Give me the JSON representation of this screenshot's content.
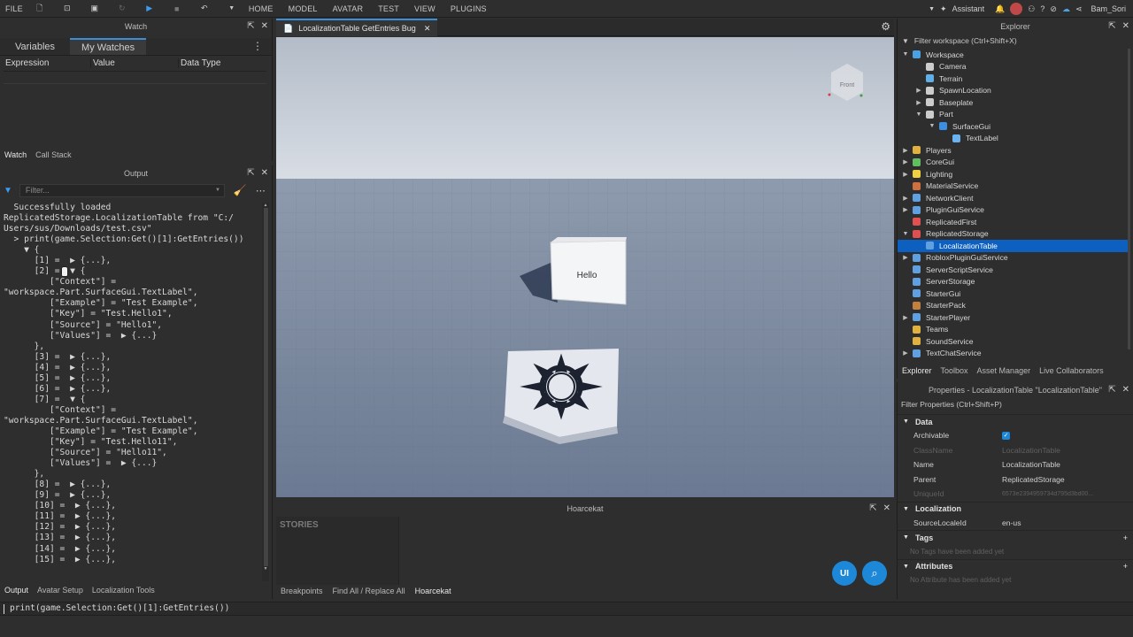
{
  "menu": {
    "file": "FILE",
    "items": [
      "HOME",
      "MODEL",
      "AVATAR",
      "TEST",
      "VIEW",
      "PLUGINS"
    ]
  },
  "topright": {
    "assistant": "Assistant",
    "user": "Bam_Sori"
  },
  "watch": {
    "title": "Watch",
    "tabs": [
      "Variables",
      "My Watches"
    ],
    "columns": [
      "Expression",
      "Value",
      "Data Type"
    ],
    "bottom_tabs": [
      "Watch",
      "Call Stack"
    ]
  },
  "output": {
    "title": "Output",
    "filter_placeholder": "Filter...",
    "lines": [
      "  Successfully loaded",
      "ReplicatedStorage.LocalizationTable from \"C:/",
      "Users/sus/Downloads/test.csv\"",
      "  > print(game.Selection:Get()[1]:GetEntries())",
      "    ▼ {",
      "      [1] =  ▶ {...},",
      "      [2] =  ▼ {",
      "         [\"Context\"] =",
      "\"workspace.Part.SurfaceGui.TextLabel\",",
      "         [\"Example\"] = \"Test Example\",",
      "         [\"Key\"] = \"Test.Hello1\",",
      "         [\"Source\"] = \"Hello1\",",
      "         [\"Values\"] =  ▶ {...}",
      "      },",
      "      [3] =  ▶ {...},",
      "      [4] =  ▶ {...},",
      "      [5] =  ▶ {...},",
      "      [6] =  ▶ {...},",
      "      [7] =  ▼ {",
      "         [\"Context\"] =",
      "\"workspace.Part.SurfaceGui.TextLabel\",",
      "         [\"Example\"] = \"Test Example\",",
      "         [\"Key\"] = \"Test.Hello11\",",
      "         [\"Source\"] = \"Hello11\",",
      "         [\"Values\"] =  ▶ {...}",
      "      },",
      "      [8] =  ▶ {...},",
      "      [9] =  ▶ {...},",
      "      [10] =  ▶ {...},",
      "      [11] =  ▶ {...},",
      "      [12] =  ▶ {...},",
      "      [13] =  ▶ {...},",
      "      [14] =  ▶ {...},",
      "      [15] =  ▶ {...},"
    ],
    "bottom_tabs": [
      "Output",
      "Avatar Setup",
      "Localization Tools"
    ]
  },
  "viewport": {
    "tab": "LocalizationTable GetEntries Bug",
    "part_text": "Hello",
    "cube_label": "Front"
  },
  "hoarcekat": {
    "title": "Hoarcekat",
    "stories": "STORIES",
    "bottom_tabs": [
      "Breakpoints",
      "Find All / Replace All",
      "Hoarcekat"
    ]
  },
  "explorer": {
    "title": "Explorer",
    "filter": "Filter workspace (Ctrl+Shift+X)",
    "items": [
      {
        "label": "Workspace",
        "depth": 0,
        "arrow": "▼",
        "color": "#4aa0e0"
      },
      {
        "label": "Camera",
        "depth": 1,
        "arrow": "",
        "color": "#cccccc"
      },
      {
        "label": "Terrain",
        "depth": 1,
        "arrow": "",
        "color": "#5fb0e8"
      },
      {
        "label": "SpawnLocation",
        "depth": 1,
        "arrow": "▶",
        "color": "#cccccc"
      },
      {
        "label": "Baseplate",
        "depth": 1,
        "arrow": "▶",
        "color": "#cccccc"
      },
      {
        "label": "Part",
        "depth": 1,
        "arrow": "▼",
        "color": "#cccccc"
      },
      {
        "label": "SurfaceGui",
        "depth": 2,
        "arrow": "▼",
        "color": "#3c8ee0"
      },
      {
        "label": "TextLabel",
        "depth": 3,
        "arrow": "",
        "color": "#6bb3f0"
      },
      {
        "label": "Players",
        "depth": 0,
        "arrow": "▶",
        "color": "#e0b040"
      },
      {
        "label": "CoreGui",
        "depth": 0,
        "arrow": "▶",
        "color": "#60c060"
      },
      {
        "label": "Lighting",
        "depth": 0,
        "arrow": "▶",
        "color": "#f0d040"
      },
      {
        "label": "MaterialService",
        "depth": 0,
        "arrow": "",
        "color": "#d07040"
      },
      {
        "label": "NetworkClient",
        "depth": 0,
        "arrow": "▶",
        "color": "#60a0e0"
      },
      {
        "label": "PluginGuiService",
        "depth": 0,
        "arrow": "▶",
        "color": "#60a0e0"
      },
      {
        "label": "ReplicatedFirst",
        "depth": 0,
        "arrow": "",
        "color": "#e05050"
      },
      {
        "label": "ReplicatedStorage",
        "depth": 0,
        "arrow": "▼",
        "color": "#e05050"
      },
      {
        "label": "LocalizationTable",
        "depth": 1,
        "arrow": "",
        "color": "#60a0e0",
        "selected": true
      },
      {
        "label": "RobloxPluginGuiService",
        "depth": 0,
        "arrow": "▶",
        "color": "#60a0e0"
      },
      {
        "label": "ServerScriptService",
        "depth": 0,
        "arrow": "",
        "color": "#60a0e0"
      },
      {
        "label": "ServerStorage",
        "depth": 0,
        "arrow": "",
        "color": "#60a0e0"
      },
      {
        "label": "StarterGui",
        "depth": 0,
        "arrow": "",
        "color": "#60a0e0"
      },
      {
        "label": "StarterPack",
        "depth": 0,
        "arrow": "",
        "color": "#c08040"
      },
      {
        "label": "StarterPlayer",
        "depth": 0,
        "arrow": "▶",
        "color": "#60a0e0"
      },
      {
        "label": "Teams",
        "depth": 0,
        "arrow": "",
        "color": "#e0b040"
      },
      {
        "label": "SoundService",
        "depth": 0,
        "arrow": "",
        "color": "#e0b040"
      },
      {
        "label": "TextChatService",
        "depth": 0,
        "arrow": "▶",
        "color": "#60a0e0"
      }
    ],
    "bottom_tabs": [
      "Explorer",
      "Toolbox",
      "Asset Manager",
      "Live Collaborators"
    ]
  },
  "properties": {
    "title": "Properties - LocalizationTable \"LocalizationTable\"",
    "filter": "Filter Properties (Ctrl+Shift+P)",
    "data_section": "Data",
    "archivable": "Archivable",
    "classname_k": "ClassName",
    "classname_v": "LocalizationTable",
    "name_k": "Name",
    "name_v": "LocalizationTable",
    "parent_k": "Parent",
    "parent_v": "ReplicatedStorage",
    "uniqueid_k": "UniqueId",
    "uniqueid_v": "6573e2394959734d795d3bd00...",
    "loc_section": "Localization",
    "source_k": "SourceLocaleId",
    "source_v": "en-us",
    "tags_section": "Tags",
    "tags_empty": "No Tags have been added yet",
    "attr_section": "Attributes",
    "attr_empty": "No Attribute has been added yet"
  },
  "command": "print(game.Selection:Get()[1]:GetEntries())",
  "colors": {
    "accent": "#3b8fd9",
    "selection": "#0e60c0"
  }
}
